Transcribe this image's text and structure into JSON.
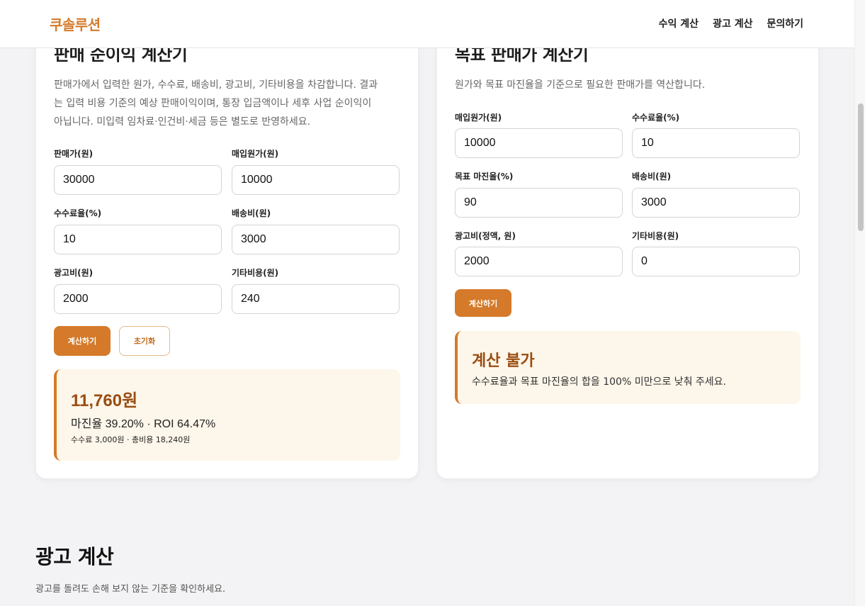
{
  "header": {
    "brand": "쿠솔루션",
    "nav": [
      "수익 계산",
      "광고 계산",
      "문의하기"
    ]
  },
  "left_card": {
    "title": "판매 순이익 계산기",
    "description_lines": [
      "판매가에서 입력한 원가, 수수료, 배송비, 광고비, 기타비용을 차감합니다. 결과",
      "는 입력 비용 기준의 예상 판매이익이며, 통장 입금액이나 세후 사업 순이익이",
      "아닙니다. 미입력 임차료·인건비·세금 등은 별도로 반영하세요."
    ],
    "fields": [
      {
        "label": "판매가(원)",
        "value": "30000"
      },
      {
        "label": "매입원가(원)",
        "value": "10000"
      },
      {
        "label": "수수료율(%)",
        "value": "10"
      },
      {
        "label": "배송비(원)",
        "value": "3000"
      },
      {
        "label": "광고비(원)",
        "value": "2000"
      },
      {
        "label": "기타비용(원)",
        "value": "240"
      }
    ],
    "calc_button": "계산하기",
    "reset_button": "초기화",
    "result": {
      "amount": "11,760원",
      "line1": "마진율 39.20% · ROI 64.47%",
      "line2": "수수료 3,000원 · 총비용 18,240원"
    }
  },
  "right_card": {
    "title": "목표 판매가 계산기",
    "description": "원가와 목표 마진율을 기준으로 필요한 판매가를 역산합니다.",
    "fields": [
      {
        "label": "매입원가(원)",
        "value": "10000"
      },
      {
        "label": "수수료율(%)",
        "value": "10"
      },
      {
        "label": "목표 마진율(%)",
        "value": "90"
      },
      {
        "label": "배송비(원)",
        "value": "3000"
      },
      {
        "label": "광고비(정액, 원)",
        "value": "2000"
      },
      {
        "label": "기타비용(원)",
        "value": "0"
      }
    ],
    "calc_button": "계산하기",
    "error": {
      "title": "계산 불가",
      "message": "수수료율과 목표 마진율의 합을 100% 미만으로 낮춰 주세요."
    }
  },
  "ad_section": {
    "title": "광고 계산",
    "description": "광고를 돌려도 손해 보지 않는 기준을 확인하세요."
  },
  "colors": {
    "accent": "#d47a2a",
    "result_bg": "#fdf6ea",
    "result_text": "#9a4d12",
    "page_bg": "#f3f3f5"
  }
}
